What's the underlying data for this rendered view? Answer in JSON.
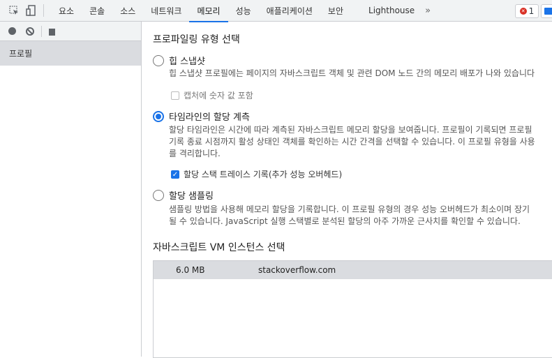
{
  "tabs": [
    "요소",
    "콘솔",
    "소스",
    "네트워크",
    "메모리",
    "성능",
    "애플리케이션",
    "보안",
    "Lighthouse"
  ],
  "active_tab": "메모리",
  "error_count": "1",
  "sidebar": {
    "item": "프로필"
  },
  "main": {
    "title": "프로파일링 유형 선택",
    "options": [
      {
        "label": "힙 스냅샷",
        "desc": [
          "힙 스냅샷 프로필에는 페이지의 자바스크립트 객체 및 관련 DOM 노드 간의 메모리 배포가 나와 있습니다"
        ],
        "checkbox": "캡처에 숫자 값 포함",
        "checked": false,
        "selected": false
      },
      {
        "label": "타임라인의 할당 계측",
        "desc": [
          "할당 타임라인은 시간에 따라 계측된 자바스크립트 메모리 할당을 보여줍니다. 프로필이 기록되면 프로필",
          "기록 종료 시점까지 활성 상태인 객체를 확인하는 시간 간격을 선택할 수 있습니다. 이 프로필 유형을 사용",
          "를 격리합니다."
        ],
        "checkbox": "할당 스택 트레이스 기록(추가 성능 오버헤드)",
        "checked": true,
        "selected": true
      },
      {
        "label": "할당 샘플링",
        "desc": [
          "샘플링 방법을 사용해 메모리 할당을 기록합니다. 이 프로필 유형의 경우 성능 오버헤드가 최소이며 장기",
          "될 수 있습니다. JavaScript 실행 스택별로 분석된 할당의 아주 가까운 근사치를 확인할 수 있습니다."
        ],
        "selected": false
      }
    ],
    "vm_title": "자바스크립트 VM 인스턴스 선택",
    "vm": {
      "size": "6.0 MB",
      "name": "stackoverflow.com"
    }
  }
}
